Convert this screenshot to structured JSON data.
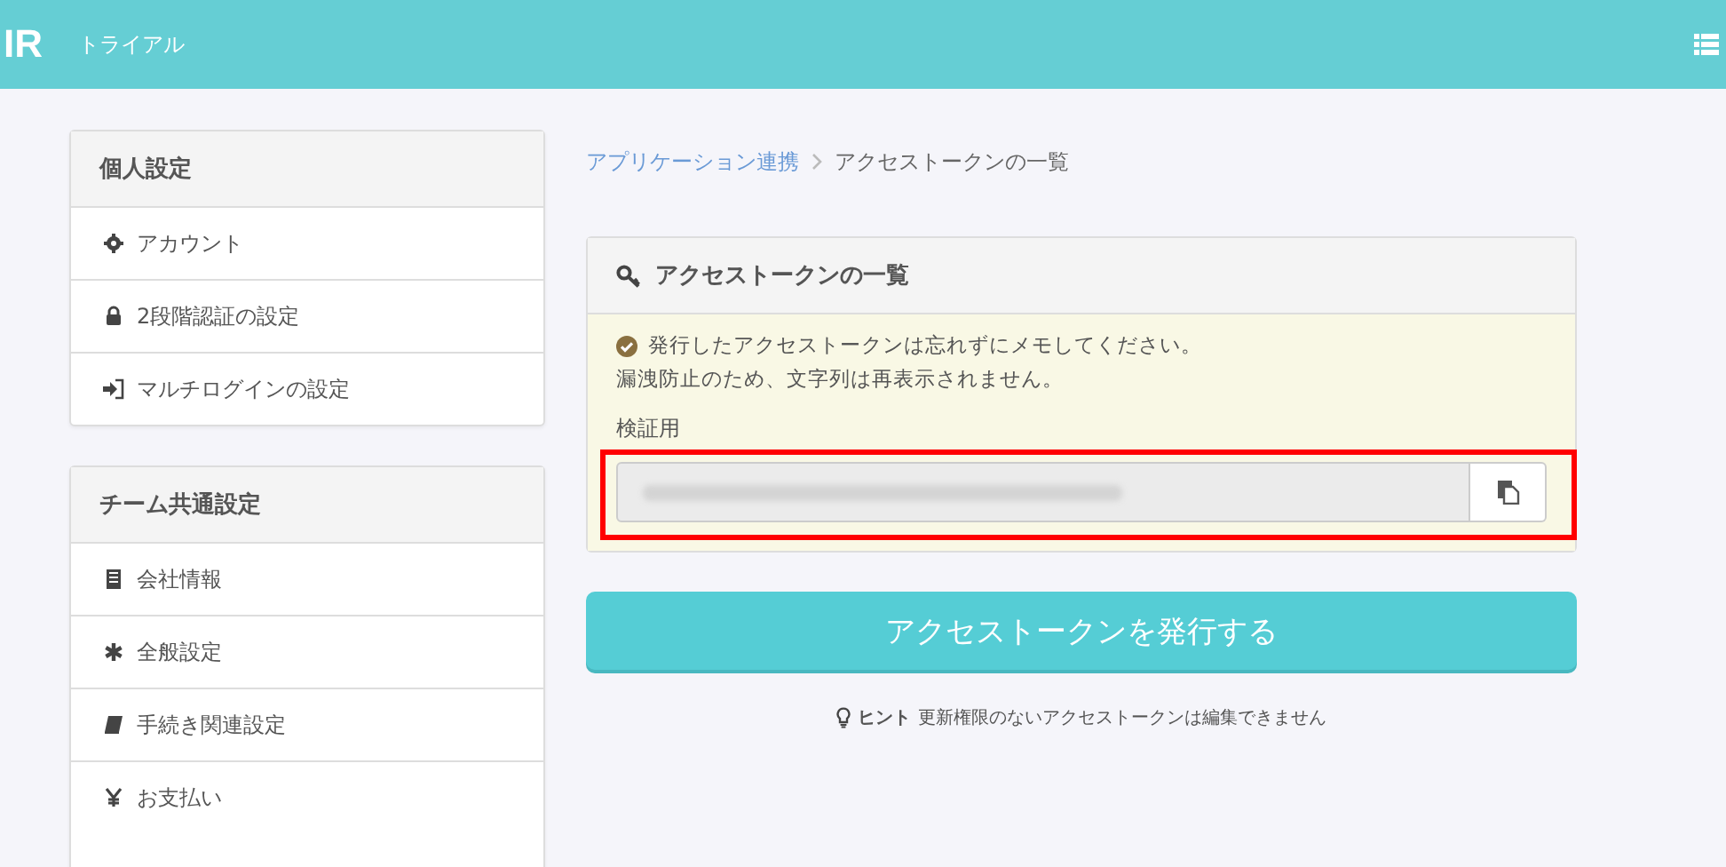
{
  "header": {
    "logo": "IR",
    "plan": "トライアル"
  },
  "sidebar": {
    "sections": [
      {
        "title": "個人設定",
        "items": [
          {
            "label": "アカウント"
          },
          {
            "label": "2段階認証の設定"
          },
          {
            "label": "マルチログインの設定"
          }
        ]
      },
      {
        "title": "チーム共通設定",
        "items": [
          {
            "label": "会社情報"
          },
          {
            "label": "全般設定"
          },
          {
            "label": "手続き関連設定"
          },
          {
            "label": "お支払い"
          }
        ]
      }
    ]
  },
  "breadcrumb": [
    {
      "label": "アプリケーション連携",
      "kind": "link"
    },
    {
      "label": "アクセストークンの一覧",
      "kind": "current"
    }
  ],
  "card": {
    "title": "アクセストークンの一覧",
    "notice": [
      "発行したアクセストークンは忘れずにメモしてください。",
      "漏洩防止のため、文字列は再表示されません。"
    ],
    "token_label": "検証用",
    "highlighted": true
  },
  "issue_button": "アクセストークンを発行する",
  "hint": {
    "label": "ヒント",
    "text": "更新権限のないアクセストークンは編集できません"
  }
}
